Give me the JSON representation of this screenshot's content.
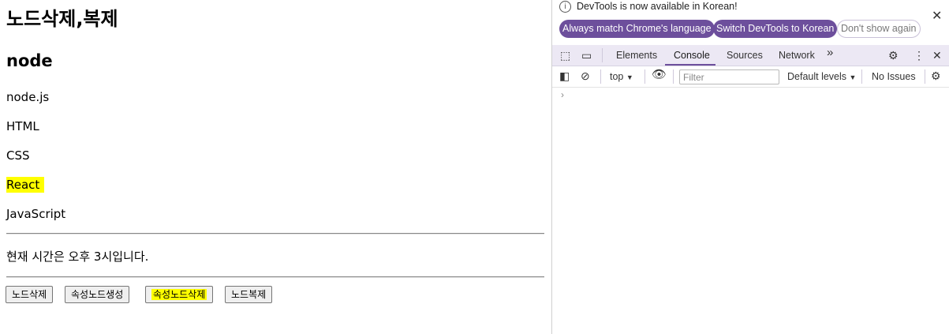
{
  "page": {
    "title": "노드삭제,복제",
    "subtitle": "node",
    "items": [
      {
        "text": "node.js",
        "highlight": false
      },
      {
        "text": "HTML",
        "highlight": false
      },
      {
        "text": "CSS",
        "highlight": false
      },
      {
        "text": "React",
        "highlight": true
      },
      {
        "text": "JavaScript",
        "highlight": false
      }
    ],
    "time_text": "현재 시간은 오후 3시입니다.",
    "buttons": {
      "delete_node": "노드삭제",
      "create_attr_node": "속성노드생성",
      "delete_attr_node": "속성노드삭제",
      "clone_node": "노드복제"
    },
    "highlight_color": "#ffff00"
  },
  "devtools": {
    "notice": {
      "info_icon": "info-icon",
      "text": "DevTools is now available in Korean!",
      "btn_match": "Always match Chrome's language",
      "btn_switch": "Switch DevTools to Korean",
      "btn_dont_show": "Don't show again"
    },
    "tabs": [
      "Elements",
      "Console",
      "Sources",
      "Network"
    ],
    "active_tab": "Console",
    "more_tabs": "»",
    "console_toolbar": {
      "context": "top",
      "filter_placeholder": "Filter",
      "levels": "Default levels",
      "issues": "No Issues"
    },
    "prompt": "›",
    "accent_color": "#6d4f9c"
  }
}
